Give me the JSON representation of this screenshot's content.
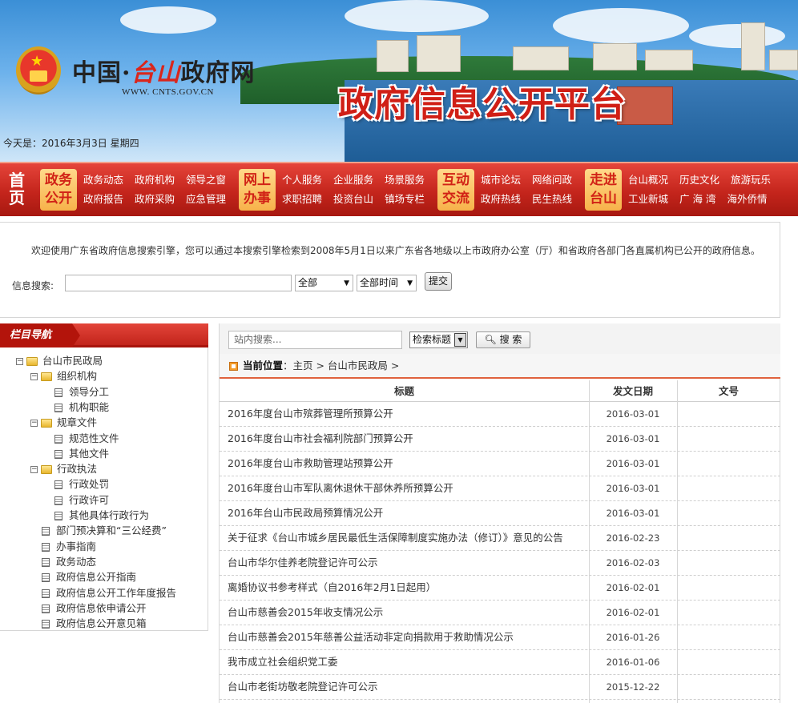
{
  "header": {
    "site_title_prefix": "中国·",
    "site_title_city": "台山",
    "site_title_suffix": "政府网",
    "site_url": "WWW. CNTS.GOV.CN",
    "platform_title": "政府信息公开平台",
    "today": "今天是：2016年3月3日 星期四"
  },
  "nav": {
    "home": "首页",
    "groups": [
      {
        "badge": "政务公开",
        "links": [
          [
            "政务动态",
            "政府机构",
            "领导之窗"
          ],
          [
            "政府报告",
            "政府采购",
            "应急管理"
          ]
        ]
      },
      {
        "badge": "网上办事",
        "links": [
          [
            "个人服务",
            "企业服务",
            "场景服务"
          ],
          [
            "求职招聘",
            "投资台山",
            "镇场专栏"
          ]
        ]
      },
      {
        "badge": "互动交流",
        "links": [
          [
            "城市论坛",
            "网络问政"
          ],
          [
            "政府热线",
            "民生热线"
          ]
        ]
      },
      {
        "badge": "走进台山",
        "links": [
          [
            "台山概况",
            "历史文化",
            "旅游玩乐"
          ],
          [
            "工业新城",
            "广 海 湾",
            "海外侨情"
          ]
        ]
      }
    ]
  },
  "search": {
    "intro": "欢迎使用广东省政府信息搜索引擎，您可以通过本搜索引擎检索到2008年5月1日以来广东省各地级以上市政府办公室（厅）和省政府各部门各直属机构已公开的政府信息。",
    "label": "信息搜索:",
    "value": "",
    "scope_selected": "全部",
    "time_selected": "全部时间",
    "submit": "提交"
  },
  "sidebar": {
    "title": "栏目导航",
    "tree": [
      {
        "label": "台山市民政局",
        "type": "folder",
        "level": 0
      },
      {
        "label": "组织机构",
        "type": "folder",
        "level": 1
      },
      {
        "label": "领导分工",
        "type": "doc",
        "level": 2
      },
      {
        "label": "机构职能",
        "type": "doc",
        "level": 2
      },
      {
        "label": "规章文件",
        "type": "folder",
        "level": 1
      },
      {
        "label": "规范性文件",
        "type": "doc",
        "level": 2
      },
      {
        "label": "其他文件",
        "type": "doc",
        "level": 2
      },
      {
        "label": "行政执法",
        "type": "folder",
        "level": 1
      },
      {
        "label": "行政处罚",
        "type": "doc",
        "level": 2
      },
      {
        "label": "行政许可",
        "type": "doc",
        "level": 2
      },
      {
        "label": "其他具体行政行为",
        "type": "doc",
        "level": 2
      },
      {
        "label": "部门预决算和“三公经费”",
        "type": "doc",
        "level": 1
      },
      {
        "label": "办事指南",
        "type": "doc",
        "level": 1
      },
      {
        "label": "政务动态",
        "type": "doc",
        "level": 1
      },
      {
        "label": "政府信息公开指南",
        "type": "doc",
        "level": 1
      },
      {
        "label": "政府信息公开工作年度报告",
        "type": "doc",
        "level": 1
      },
      {
        "label": "政府信息依申请公开",
        "type": "doc",
        "level": 1
      },
      {
        "label": "政府信息公开意见箱",
        "type": "doc",
        "level": 1
      }
    ]
  },
  "main": {
    "site_search_placeholder": "站内搜索...",
    "search_type": "检索标题",
    "search_button": "搜 索",
    "breadcrumb_label": "当前位置",
    "breadcrumb_path": "：主页 > 台山市民政局 >",
    "columns": [
      "标题",
      "发文日期",
      "文号"
    ],
    "rows": [
      {
        "title": "2016年度台山市殡葬管理所预算公开",
        "date": "2016-03-01",
        "number": ""
      },
      {
        "title": "2016年度台山市社会福利院部门预算公开",
        "date": "2016-03-01",
        "number": ""
      },
      {
        "title": "2016年度台山市救助管理站预算公开",
        "date": "2016-03-01",
        "number": ""
      },
      {
        "title": "2016年度台山市军队离休退休干部休养所预算公开",
        "date": "2016-03-01",
        "number": ""
      },
      {
        "title": "2016年台山市民政局预算情况公开",
        "date": "2016-03-01",
        "number": ""
      },
      {
        "title": "关于征求《台山市城乡居民最低生活保障制度实施办法（修订）》意见的公告",
        "date": "2016-02-23",
        "number": ""
      },
      {
        "title": "台山市华尔佳养老院登记许可公示",
        "date": "2016-02-03",
        "number": ""
      },
      {
        "title": "离婚协议书参考样式（自2016年2月1日起用）",
        "date": "2016-02-01",
        "number": ""
      },
      {
        "title": "台山市慈善会2015年收支情况公示",
        "date": "2016-02-01",
        "number": ""
      },
      {
        "title": "台山市慈善会2015年慈善公益活动非定向捐款用于救助情况公示",
        "date": "2016-01-26",
        "number": ""
      },
      {
        "title": "我市成立社会组织党工委",
        "date": "2016-01-06",
        "number": ""
      },
      {
        "title": "台山市老街坊敬老院登记许可公示",
        "date": "2015-12-22",
        "number": ""
      }
    ]
  }
}
